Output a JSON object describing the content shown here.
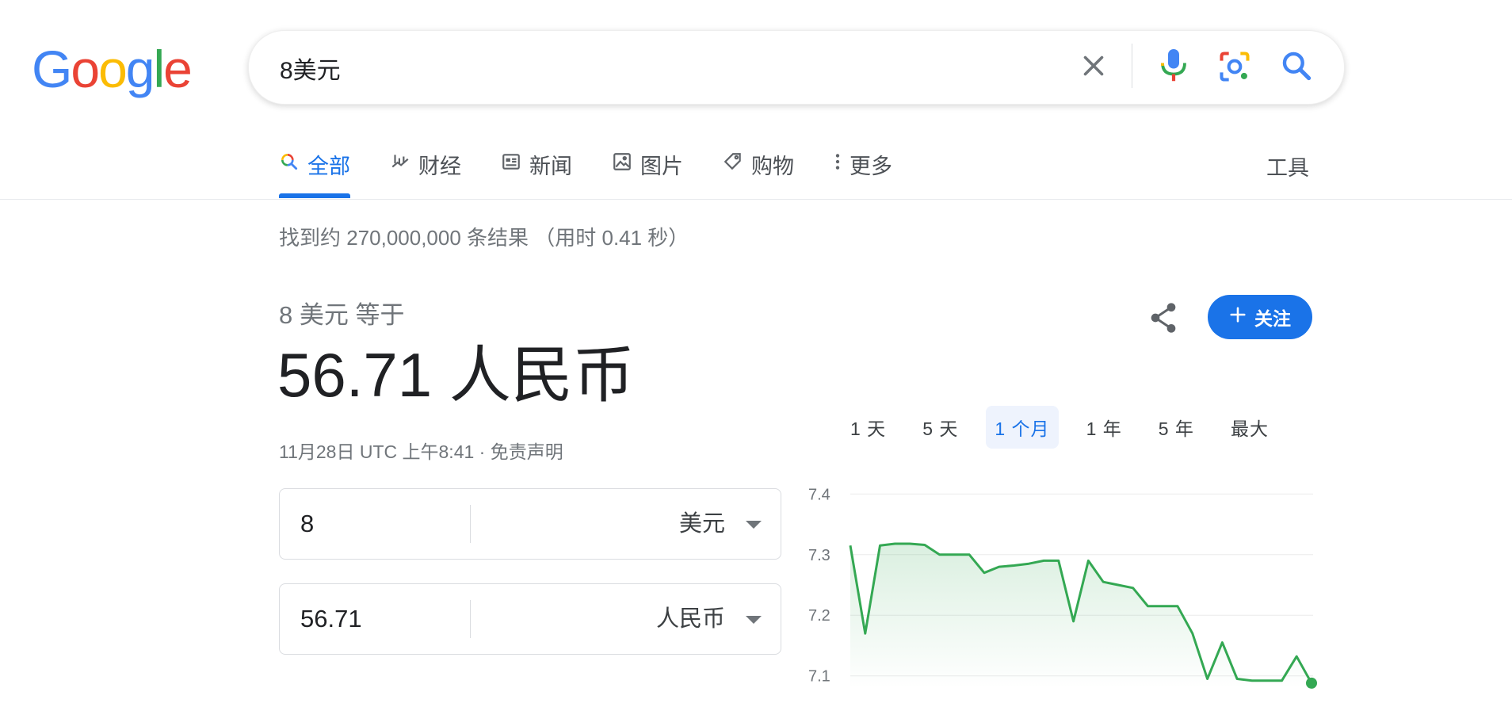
{
  "header": {
    "logo_text": "Google",
    "logo_colors": [
      "#4285F4",
      "#EA4335",
      "#FBBC05",
      "#4285F4",
      "#34A853",
      "#EA4335"
    ],
    "search_query": "8美元",
    "icons": [
      "close-icon",
      "mic-icon",
      "lens-icon",
      "search-icon"
    ]
  },
  "tabs": [
    {
      "label": "全部",
      "icon": "search-icon",
      "active": true
    },
    {
      "label": "财经",
      "icon": "finance-icon",
      "active": false
    },
    {
      "label": "新闻",
      "icon": "news-icon",
      "active": false
    },
    {
      "label": "图片",
      "icon": "image-icon",
      "active": false
    },
    {
      "label": "购物",
      "icon": "tag-icon",
      "active": false
    },
    {
      "label": "更多",
      "icon": "more-vert-icon",
      "active": false
    }
  ],
  "tools_label": "工具",
  "result_stats": "找到约 270,000,000 条结果 （用时 0.41 秒）",
  "converter": {
    "label": "8 美元 等于",
    "result": "56.71 人民币",
    "timestamp": "11月28日 UTC 上午8:41",
    "separator": " · ",
    "disclaimer": "免责声明",
    "follow_label": "关注",
    "from_value": "8",
    "from_currency": "美元",
    "to_value": "56.71",
    "to_currency": "人民币",
    "accent": "#1a73e8"
  },
  "ranges": [
    {
      "label": "1 天",
      "active": false
    },
    {
      "label": "5 天",
      "active": false
    },
    {
      "label": "1 个月",
      "active": true
    },
    {
      "label": "1 年",
      "active": false
    },
    {
      "label": "5 年",
      "active": false
    },
    {
      "label": "最大",
      "active": false
    }
  ],
  "chart_data": {
    "type": "area",
    "title": "",
    "ylim": [
      7.08,
      7.42
    ],
    "y_ticks": [
      7.4,
      7.3,
      7.2,
      7.1
    ],
    "y_tick_labels": [
      "7.4",
      "7.3",
      "7.2",
      "7.1"
    ],
    "grid": true,
    "line_color": "#34A853",
    "series": [
      {
        "values": [
          7.315,
          7.17,
          7.315,
          7.318,
          7.318,
          7.316,
          7.3,
          7.3,
          7.3,
          7.27,
          7.28,
          7.282,
          7.285,
          7.29,
          7.29,
          7.19,
          7.29,
          7.255,
          7.25,
          7.245,
          7.215,
          7.215,
          7.215,
          7.17,
          7.095,
          7.155,
          7.095,
          7.092,
          7.092,
          7.092,
          7.132,
          7.088
        ]
      }
    ]
  }
}
